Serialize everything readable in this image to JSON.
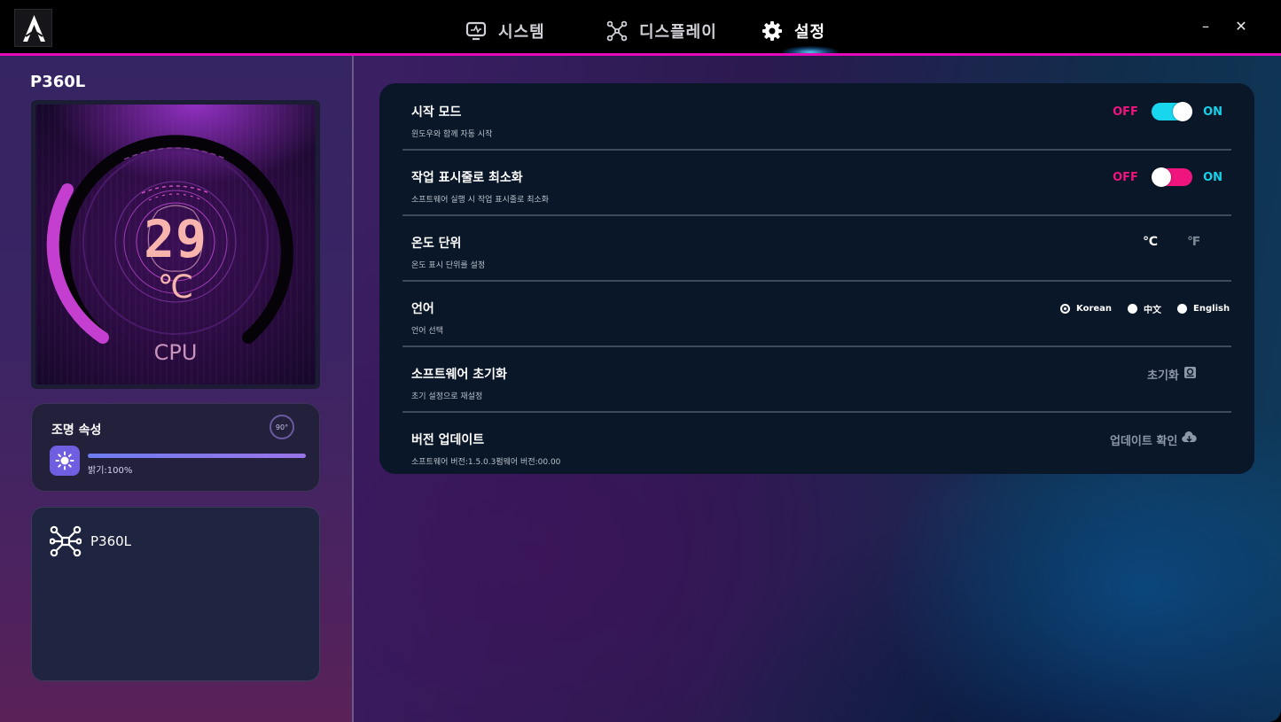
{
  "app": {
    "tabs": [
      {
        "label": "시스템",
        "icon": "monitor-icon"
      },
      {
        "label": "디스플레이",
        "icon": "network-nodes-icon"
      },
      {
        "label": "설정",
        "icon": "gear-icon",
        "active": true
      }
    ],
    "window_controls": {
      "minimize": "–",
      "close": "✕"
    }
  },
  "sidebar": {
    "device_title": "P360L",
    "cpu": {
      "temperature": "29",
      "unit": "℃",
      "label": "CPU"
    },
    "lighting": {
      "title": "조명 속성",
      "rotate_label": "90°",
      "brightness_label": "밝기:100%",
      "brightness": 100
    },
    "device_card": {
      "name": "P360L"
    }
  },
  "settings": {
    "startup": {
      "title": "시작 모드",
      "desc": "윈도우와 함께 자동 시작",
      "off": "OFF",
      "on": "ON",
      "state": "on"
    },
    "minimize_tray": {
      "title": "작업 표시줄로 최소화",
      "desc": "소프트웨어 실행 시 작업 표시줄로 최소화",
      "off": "OFF",
      "on": "ON",
      "state": "off"
    },
    "temp_unit": {
      "title": "온도 단위",
      "desc": "온도 표시 단위를 설정",
      "celsius": "℃",
      "fahrenheit": "℉",
      "selected": "celsius"
    },
    "language": {
      "title": "언어",
      "desc": "언어 선택",
      "options": [
        "Korean",
        "中文",
        "English"
      ],
      "selected": "Korean"
    },
    "reset": {
      "title": "소프트웨어 초기화",
      "desc": "초기 설정으로 재설정",
      "button": "초기화"
    },
    "update": {
      "title": "버전 업데이트",
      "desc": "소프트웨어 버전:1.5.0.3펌웨어 버전:00.00",
      "button": "업데이트 확인"
    }
  },
  "colors": {
    "accent_magenta": "#e40ab9",
    "toggle_on": "#17d6ee",
    "toggle_off": "#f0147f",
    "temp_text": "#f8b5ad"
  }
}
